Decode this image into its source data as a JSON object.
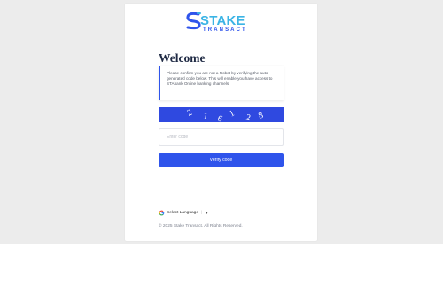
{
  "brand": {
    "line1": "STAKE",
    "line2": "TRANSACT",
    "primary_color": "#2f54eb",
    "accent_color": "#3bb4e5"
  },
  "welcome": {
    "title": "Welcome"
  },
  "notice": {
    "text": "Please confirm you are not a Robot by verifying the auto-generated code below. This will enable you have access to STAbank Online banking channels."
  },
  "captcha": {
    "code": "216128",
    "background": "#2f49e0"
  },
  "code_input": {
    "placeholder": "Enter code",
    "value": ""
  },
  "verify_button": {
    "label": "Verify code"
  },
  "language": {
    "label": "Select Language",
    "separator": "|",
    "arrow": "▼",
    "icon": "google-icon"
  },
  "footer": {
    "text": "© 2025 Stake Transact. All Rights Reserved."
  }
}
